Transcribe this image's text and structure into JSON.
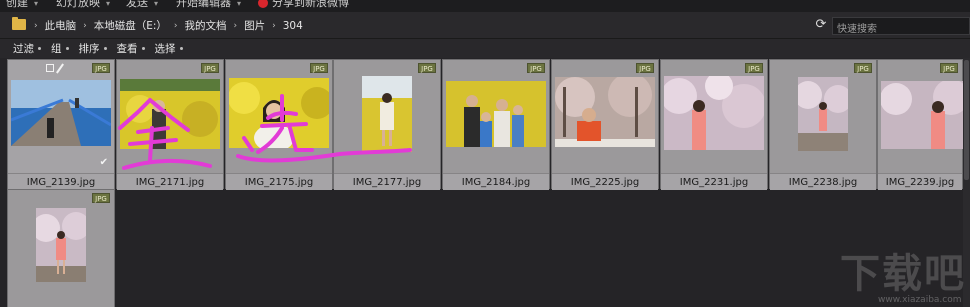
{
  "topmenu": {
    "items": [
      "创建",
      "幻灯放映",
      "发送",
      "开始编辑器",
      "分享到新浪微博"
    ]
  },
  "address": {
    "crumbs": [
      "此电脑",
      "本地磁盘（E:）",
      "我的文档",
      "图片",
      "304"
    ],
    "search_placeholder": "快速搜索"
  },
  "toolbar": {
    "items": [
      "过滤",
      "组",
      "排序",
      "查看",
      "选择"
    ]
  },
  "tiles": [
    {
      "name": "IMG_2139.jpg",
      "badge": "JPG",
      "selected": true
    },
    {
      "name": "IMG_2171.jpg",
      "badge": "JPG"
    },
    {
      "name": "IMG_2175.jpg",
      "badge": "JPG"
    },
    {
      "name": "IMG_2177.jpg",
      "badge": "JPG"
    },
    {
      "name": "IMG_2184.jpg",
      "badge": "JPG"
    },
    {
      "name": "IMG_2225.jpg",
      "badge": "JPG"
    },
    {
      "name": "IMG_2231.jpg",
      "badge": "JPG"
    },
    {
      "name": "IMG_2238.jpg",
      "badge": "JPG"
    },
    {
      "name": "IMG_2239.jpg",
      "badge": "JPG"
    },
    {
      "name": "",
      "badge": "JPG"
    }
  ],
  "annotation": {
    "text": "全选",
    "color": "#e23bd6"
  },
  "watermark": {
    "big": "下载吧",
    "small": "www.xiazaiba.com"
  }
}
